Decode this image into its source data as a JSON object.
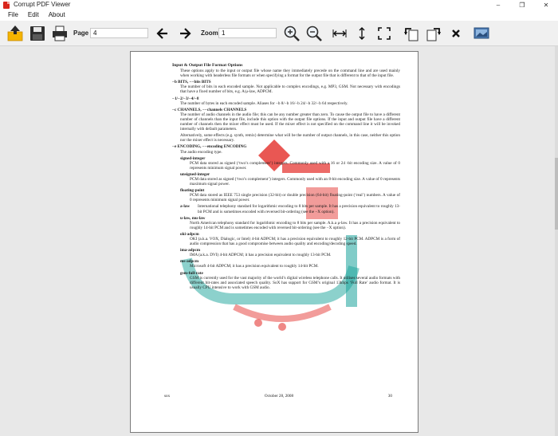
{
  "window": {
    "title": "Corrupt PDF Viewer",
    "min": "–",
    "max": "❐",
    "close": "✕"
  },
  "menu": [
    "File",
    "Edit",
    "About"
  ],
  "toolbar": {
    "page_label": "Page",
    "page_value": "4",
    "zoom_label": "Zoom",
    "zoom_value": "1"
  },
  "document": {
    "section_title": "Input & Output File Format Options",
    "intro": "These options apply to the input or output file whose name they immediately precede on the command line and are used mainly when working with headerless file formats or when specifying a format for the output file that is different to that of the input file.",
    "b_opt": "−b BITS, −−bits BITS",
    "b_desc": "The number of bits in each encoded sample. Not applicable to complex encodings, e.g. MP3, GSM. Not necessary with encodings that have a fixed number of bits, e.g. A/μ-law, ADPCM.",
    "n_opt": "−1/−2/−3/−4/−8",
    "n_desc": "The number of bytes in each encoded sample. Aliases for −b 8/−b 16/−b 24/−b 32/−b 64 respectively.",
    "c_opt": "−c CHANNELS, −−channels CHANNELS",
    "c_desc": "The number of audio channels in the audio file; this can be any number greater than zero. To cause the output file to have a different number of channels than the input file, include this option with the output file options. If the input and output file have a different number of channels then the mixer effect must be used. If the mixer effect is not specified on the command line it will be invoked internally with default parameters.",
    "c_desc2": "Alternatively, some effects (e.g. synth, remix) determine what will be the number of output channels, in this case, neither this option nor the mixer effect is necessary.",
    "e_opt": "−e ENCODING, −−encoding ENCODING",
    "e_desc": "The audio encoding type.",
    "enc": [
      {
        "name": "signed-integer",
        "desc": "PCM data stored as signed (‘two’s complement’) integers. Commonly used with a 16 or 24 -bit encoding size. A value of 0 represents minimum signal power."
      },
      {
        "name": "unsigned-integer",
        "desc": "PCM data stored as signed (‘two’s complement’) integers. Commonly used with an 8-bit encoding size. A value of 0 represents maximum signal power."
      },
      {
        "name": "floating-point",
        "desc": "PCM data stored as IEEE 753 single precision (32-bit) or double precision (64-bit) floating-point (‘real’) numbers. A value of 0 represents minimum signal power."
      }
    ],
    "alaw_name": "a-law",
    "alaw_desc": "International telephony standard for logarithmic encoding to 8 bits per sample. It has a precision equivalent to roughly 13-bit PCM and is sometimes encoded with reversed bit-ordering (see the −X option).",
    "ulaw_name": "u-law, mu-law",
    "ulaw_desc": "North American telephony standard for logarithmic encoding to 8 bits per sample. A.k.a μ-law. It has a precision equivalent to roughly 14-bit PCM and is sometimes encoded with reversed bit-ordering (see the −X option).",
    "enc2": [
      {
        "name": "oki-adpcm",
        "desc": "OKI (a.k.a. VOX, Dialogic, or Intel) 4-bit ADPCM; it has a precision equivalent to roughly 12-bit PCM. ADPCM is a form of audio compression that has a good compromise between audio quality and encoding/decoding speed."
      },
      {
        "name": "ima-adpcm",
        "desc": "IMA (a.k.a. DVI) 4-bit ADPCM; it has a precision equivalent to roughly 13-bit PCM."
      },
      {
        "name": "ms-adpcm",
        "desc": "Microsoft 4-bit ADPCM; it has a precision equivalent to roughly 14-bit PCM."
      },
      {
        "name": "gsm-full-rate",
        "desc": "GSM is currently used for the vast majority of the world’s digital wireless telephone calls. It utilises several audio formats with different bit-rates and associated speech quality. SoX has support for GSM’s original 13kbps ‘Full Rate’ audio format. It is usually CPU intensive to work with GSM audio."
      }
    ],
    "footer_left": "sox",
    "footer_center": "October 28, 2008",
    "footer_right": "30"
  },
  "colors": {
    "watermark_red": "#e53935",
    "watermark_teal": "#1aa39a"
  }
}
